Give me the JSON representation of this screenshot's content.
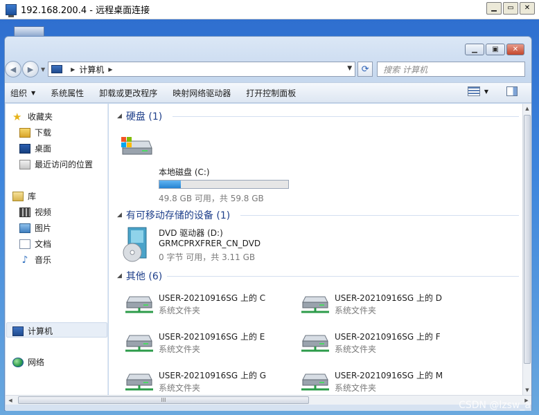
{
  "rdp_window": {
    "title": "192.168.200.4 - 远程桌面连接",
    "buttons": [
      "▁",
      "▭",
      "✕"
    ]
  },
  "explorer": {
    "buttons": [
      "▁",
      "▣",
      "✕"
    ],
    "address": {
      "location": "计算机"
    },
    "search_placeholder": "搜索 计算机",
    "toolbar": {
      "organize": "组织",
      "system_properties": "系统属性",
      "uninstall": "卸载或更改程序",
      "map_drive": "映射网络驱动器",
      "control_panel": "打开控制面板"
    },
    "nav": {
      "favorites": "收藏夹",
      "downloads": "下载",
      "desktop": "桌面",
      "recent": "最近访问的位置",
      "libraries": "库",
      "videos": "视频",
      "pictures": "图片",
      "documents": "文档",
      "music": "音乐",
      "computer": "计算机",
      "network": "网络"
    },
    "groups": {
      "hard_disk": {
        "header": "硬盘 (1)",
        "drive": {
          "name": "本地磁盘 (C:)",
          "info": "49.8 GB 可用，共 59.8 GB",
          "used_fraction": 0.167
        }
      },
      "removable": {
        "header": "有可移动存储的设备 (1)",
        "drive": {
          "name": "DVD 驱动器 (D:)",
          "label": "GRMCPRXFRER_CN_DVD",
          "info": "0 字节 可用，共 3.11 GB"
        }
      },
      "other": {
        "header": "其他 (6)",
        "items": [
          {
            "name": "USER-20210916SG 上的 C",
            "type": "系统文件夹"
          },
          {
            "name": "USER-20210916SG 上的 D",
            "type": "系统文件夹"
          },
          {
            "name": "USER-20210916SG 上的 E",
            "type": "系统文件夹"
          },
          {
            "name": "USER-20210916SG 上的 F",
            "type": "系统文件夹"
          },
          {
            "name": "USER-20210916SG 上的 G",
            "type": "系统文件夹"
          },
          {
            "name": "USER-20210916SG 上的 M",
            "type": "系统文件夹"
          }
        ]
      }
    },
    "hscroll_grip": "III"
  },
  "watermark": "CSDN @lzsw_a"
}
